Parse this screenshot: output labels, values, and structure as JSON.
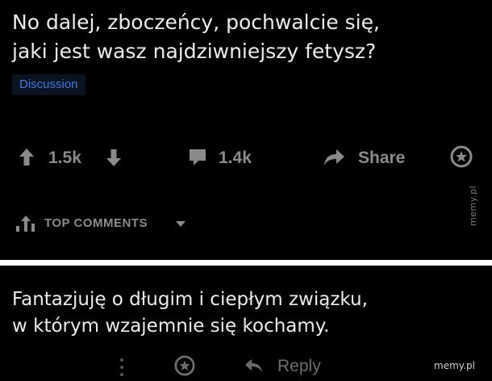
{
  "post": {
    "title_lines": [
      "No dalej, zboczeńcy, pochwalcie się,",
      "jaki jest wasz najdziwniejszy fetysz?"
    ],
    "flair": "Discussion",
    "votes": "1.5k",
    "comments": "1.4k",
    "share_label": "Share"
  },
  "comments_section": {
    "sort_label": "TOP COMMENTS"
  },
  "comment": {
    "body_lines": [
      "Fantazjuję o długim i ciepłym związku,",
      "w którym wzajemnie się kochamy."
    ],
    "reply_label": "Reply"
  },
  "watermarks": {
    "side": "memy.pl",
    "corner": "memy.pl"
  },
  "icons": [
    "upvote-icon",
    "downvote-icon",
    "comment-icon",
    "share-icon",
    "award-icon",
    "sort-icon",
    "chevron-down-icon",
    "more-icon",
    "reply-icon"
  ],
  "colors": {
    "background": "#000000",
    "text": "#ececec",
    "muted": "#8a8a8a",
    "flair_text": "#3d7ce8",
    "separator": "#ffffff"
  }
}
